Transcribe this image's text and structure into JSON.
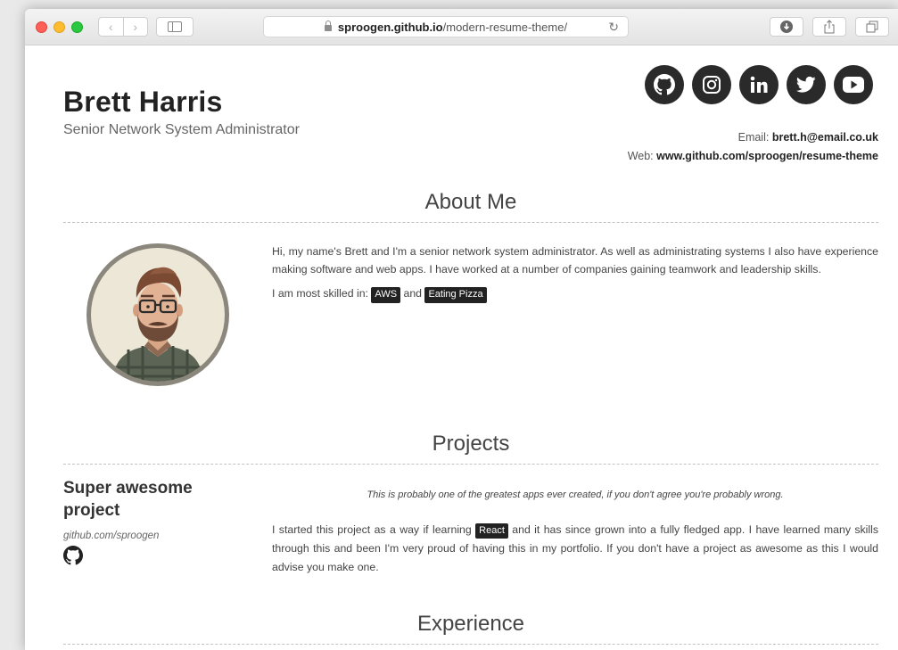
{
  "browser": {
    "url_domain": "sproogen.github.io",
    "url_path": "/modern-resume-theme/"
  },
  "header": {
    "name": "Brett Harris",
    "title": "Senior Network System Administrator",
    "email_label": "Email:",
    "email": "brett.h@email.co.uk",
    "web_label": "Web:",
    "web": "www.github.com/sproogen/resume-theme",
    "socials": [
      "github-icon",
      "instagram-icon",
      "linkedin-icon",
      "twitter-icon",
      "youtube-icon"
    ]
  },
  "about": {
    "heading": "About Me",
    "paragraph": "Hi, my name's Brett and I'm a senior network system administrator. As well as administrating systems I also have experience making software and web apps. I have worked at a number of companies gaining teamwork and leadership skills.",
    "skills_prefix": "I am most skilled in:",
    "skill_1": "AWS",
    "skills_and": "and",
    "skill_2": "Eating Pizza"
  },
  "projects": {
    "heading": "Projects",
    "items": [
      {
        "name": "Super awesome project",
        "link": "github.com/sproogen",
        "quote": "This is probably one of the greatest apps ever created, if you don't agree you're probably wrong.",
        "desc_before": "I started this project as a way if learning",
        "tech": "React",
        "desc_after": "and it has since grown into a fully fledged app. I have learned many skills through this and been I'm very proud of having this in my portfolio. If you don't have a project as awesome as this I would advise you make one."
      }
    ]
  },
  "experience": {
    "heading": "Experience"
  }
}
